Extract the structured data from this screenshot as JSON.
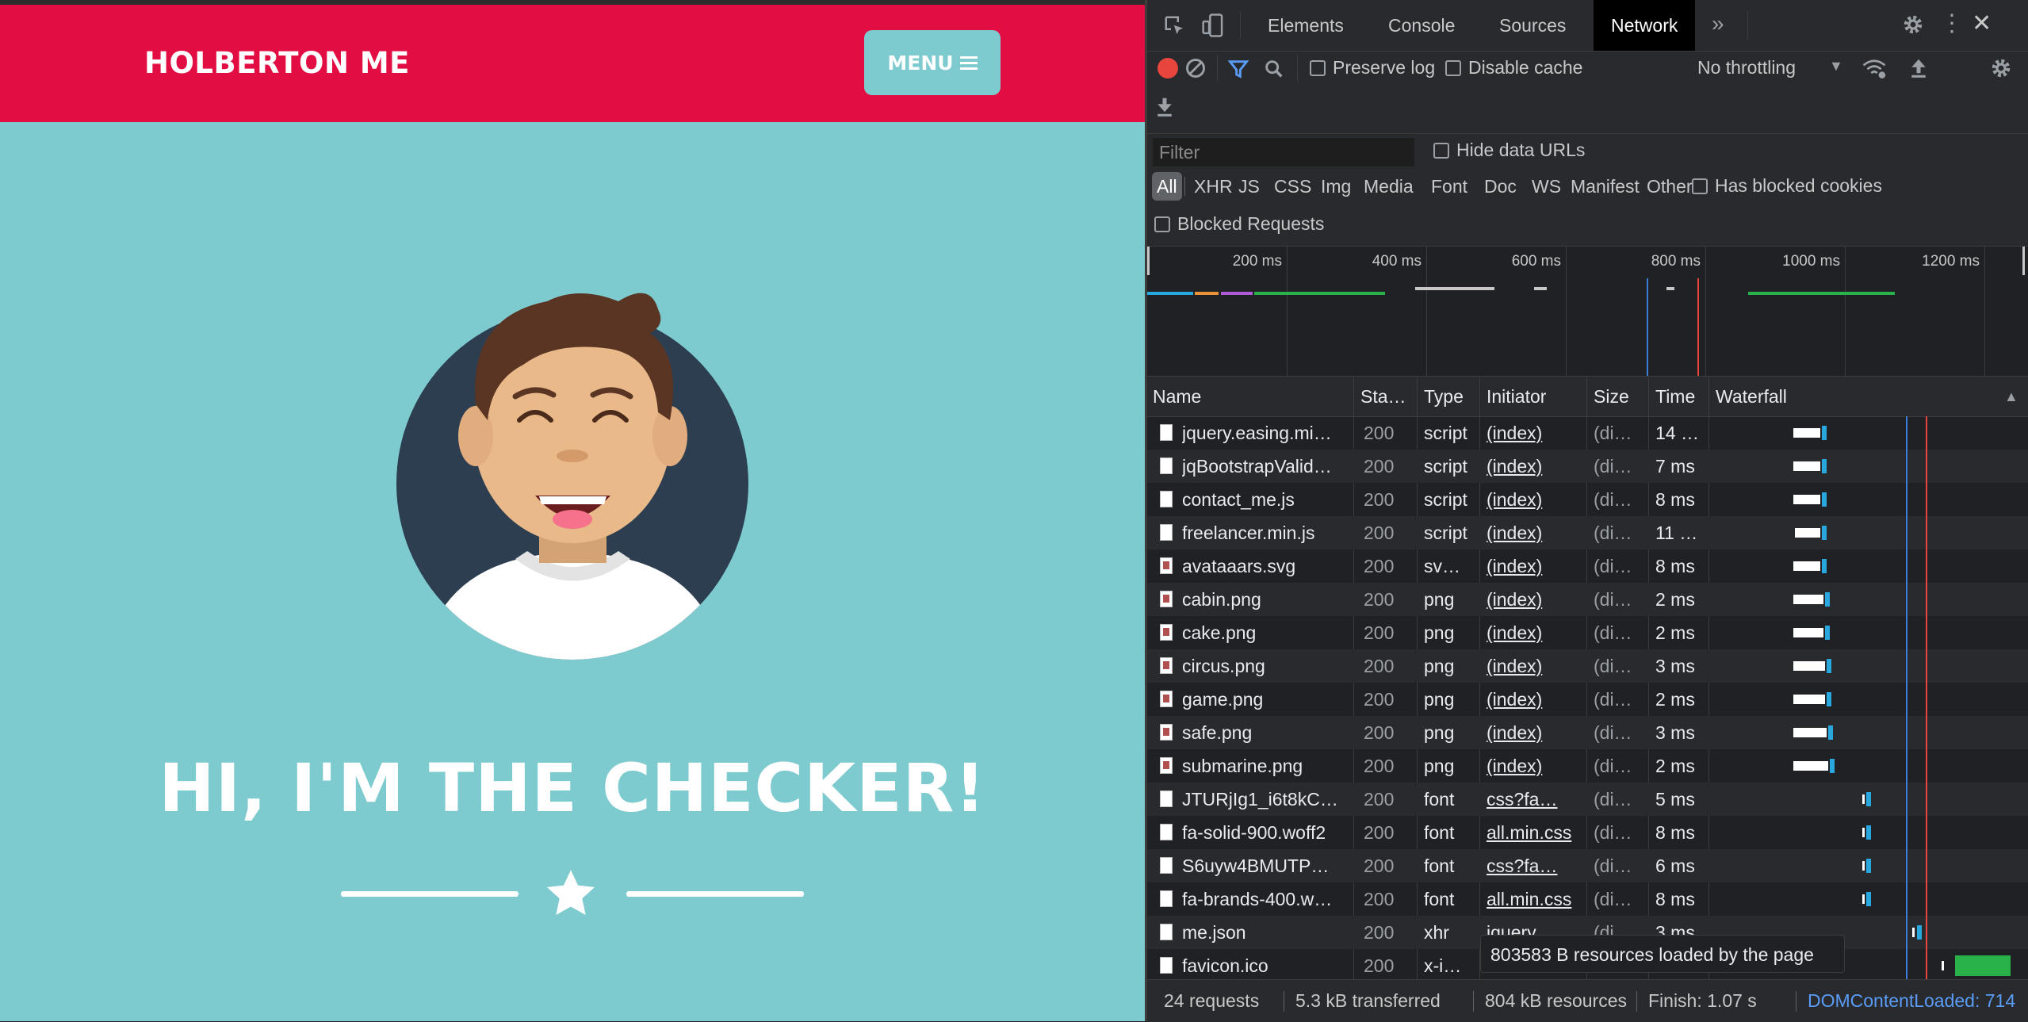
{
  "site": {
    "brand": "HOLBERTON ME",
    "menu_label": "MENU",
    "hero_title": "HI, I'M THE CHECKER!",
    "colors": {
      "nav": "#e20d42",
      "background": "#7ecbcf"
    }
  },
  "devtools": {
    "tabs": [
      "Elements",
      "Console",
      "Sources",
      "Network"
    ],
    "active_tab": "Network",
    "toolbar": {
      "preserve_log": "Preserve log",
      "disable_cache": "Disable cache",
      "throttling": "No throttling"
    },
    "filter": {
      "placeholder": "Filter",
      "hide_data_urls": "Hide data URLs",
      "types": [
        "All",
        "XHR",
        "JS",
        "CSS",
        "Img",
        "Media",
        "Font",
        "Doc",
        "WS",
        "Manifest",
        "Other"
      ],
      "has_blocked_cookies": "Has blocked cookies",
      "blocked_requests": "Blocked Requests"
    },
    "overview_ticks": [
      "200 ms",
      "400 ms",
      "600 ms",
      "800 ms",
      "1000 ms",
      "1200 ms"
    ],
    "columns": {
      "name": "Name",
      "status": "Sta…",
      "type": "Type",
      "initiator": "Initiator",
      "size": "Size",
      "time": "Time",
      "waterfall": "Waterfall"
    },
    "requests": [
      {
        "name": "jquery.easing.mi…",
        "status": "200",
        "type": "script",
        "initiator": "(index)",
        "size": "(di…",
        "time": "14 …",
        "icon": "doc"
      },
      {
        "name": "jqBootstrapValid…",
        "status": "200",
        "type": "script",
        "initiator": "(index)",
        "size": "(di…",
        "time": "7 ms",
        "icon": "doc"
      },
      {
        "name": "contact_me.js",
        "status": "200",
        "type": "script",
        "initiator": "(index)",
        "size": "(di…",
        "time": "8 ms",
        "icon": "doc"
      },
      {
        "name": "freelancer.min.js",
        "status": "200",
        "type": "script",
        "initiator": "(index)",
        "size": "(di…",
        "time": "11 …",
        "icon": "doc"
      },
      {
        "name": "avataaars.svg",
        "status": "200",
        "type": "sv…",
        "initiator": "(index)",
        "size": "(di…",
        "time": "8 ms",
        "icon": "img"
      },
      {
        "name": "cabin.png",
        "status": "200",
        "type": "png",
        "initiator": "(index)",
        "size": "(di…",
        "time": "2 ms",
        "icon": "img"
      },
      {
        "name": "cake.png",
        "status": "200",
        "type": "png",
        "initiator": "(index)",
        "size": "(di…",
        "time": "2 ms",
        "icon": "img"
      },
      {
        "name": "circus.png",
        "status": "200",
        "type": "png",
        "initiator": "(index)",
        "size": "(di…",
        "time": "3 ms",
        "icon": "img"
      },
      {
        "name": "game.png",
        "status": "200",
        "type": "png",
        "initiator": "(index)",
        "size": "(di…",
        "time": "2 ms",
        "icon": "img"
      },
      {
        "name": "safe.png",
        "status": "200",
        "type": "png",
        "initiator": "(index)",
        "size": "(di…",
        "time": "3 ms",
        "icon": "img"
      },
      {
        "name": "submarine.png",
        "status": "200",
        "type": "png",
        "initiator": "(index)",
        "size": "(di…",
        "time": "2 ms",
        "icon": "img"
      },
      {
        "name": "JTURjIg1_i6t8kC…",
        "status": "200",
        "type": "font",
        "initiator": "css?fa…",
        "size": "(di…",
        "time": "5 ms",
        "icon": "doc"
      },
      {
        "name": "fa-solid-900.woff2",
        "status": "200",
        "type": "font",
        "initiator": "all.min.css",
        "size": "(di…",
        "time": "8 ms",
        "icon": "doc"
      },
      {
        "name": "S6uyw4BMUTP…",
        "status": "200",
        "type": "font",
        "initiator": "css?fa…",
        "size": "(di…",
        "time": "6 ms",
        "icon": "doc"
      },
      {
        "name": "fa-brands-400.w…",
        "status": "200",
        "type": "font",
        "initiator": "all.min.css",
        "size": "(di…",
        "time": "8 ms",
        "icon": "doc"
      },
      {
        "name": "me.json",
        "status": "200",
        "type": "xhr",
        "initiator": "jquery.…",
        "size": "(di…",
        "time": "3 ms",
        "icon": "doc"
      },
      {
        "name": "favicon.ico",
        "status": "200",
        "type": "x-i…",
        "initiator": "",
        "size": "",
        "time": "",
        "icon": "doc"
      }
    ],
    "tooltip": "803583 B resources loaded by the page",
    "status": {
      "requests": "24 requests",
      "transferred": "5.3 kB transferred",
      "resources": "804 kB resources",
      "finish": "Finish: 1.07 s",
      "dcl": "DOMContentLoaded: 714"
    }
  }
}
